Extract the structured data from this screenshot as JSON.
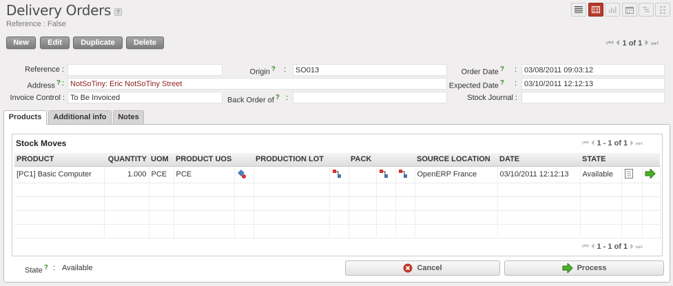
{
  "header": {
    "title": "Delivery Orders",
    "help_badge": "?",
    "subtitle": "Reference : False"
  },
  "view_switcher": [
    "list-view-icon",
    "form-view-icon",
    "graph-view-icon",
    "calendar-view-icon",
    "gantt-view-icon",
    "diagram-view-icon"
  ],
  "toolbar": {
    "new": "New",
    "edit": "Edit",
    "duplicate": "Duplicate",
    "delete": "Delete"
  },
  "pager": {
    "count": "1 of 1"
  },
  "form": {
    "reference_label": "Reference :",
    "reference_value": "",
    "origin_label": "Origin",
    "origin_value": "SO013",
    "order_date_label": "Order Date",
    "order_date_value": "03/08/2011 09:03:12",
    "address_label": "Address",
    "address_value": "NotSoTiny: Eric NotSoTiny Street",
    "expected_date_label": "Expected Date",
    "expected_date_value": "03/10/2011 12:12:13",
    "invoice_control_label": "Invoice Control :",
    "invoice_control_value": "To Be Invoiced",
    "back_order_label": "Back Order of",
    "back_order_value": "",
    "stock_journal_label": "Stock Journal :",
    "stock_journal_value": "",
    "help_q": "?",
    "colon": ":"
  },
  "tabs": [
    {
      "label": "Products"
    },
    {
      "label": "Additional info"
    },
    {
      "label": "Notes"
    }
  ],
  "stock_moves": {
    "title": "Stock Moves",
    "pager": "1 - 1 of 1",
    "columns": [
      "PRODUCT",
      "QUANTITY",
      "UOM",
      "PRODUCT UOS",
      "PRODUCTION LOT",
      "PACK",
      "SOURCE LOCATION",
      "DATE",
      "STATE"
    ],
    "rows": [
      {
        "product": "[PC1] Basic Computer",
        "quantity": "1.000",
        "uom": "PCE",
        "product_uos": "PCE",
        "source_location": "OpenERP France",
        "date": "03/10/2011 12:12:13",
        "state": "Available"
      }
    ]
  },
  "footer": {
    "state_label": "State",
    "state_value": "Available",
    "cancel": "Cancel",
    "process": "Process"
  },
  "colors": {
    "active_view": "#b73a2c",
    "link_red": "#8b1c1c",
    "help_green": "#3a8d2b",
    "cancel_red": "#c0392b",
    "process_green": "#4caf2a"
  }
}
